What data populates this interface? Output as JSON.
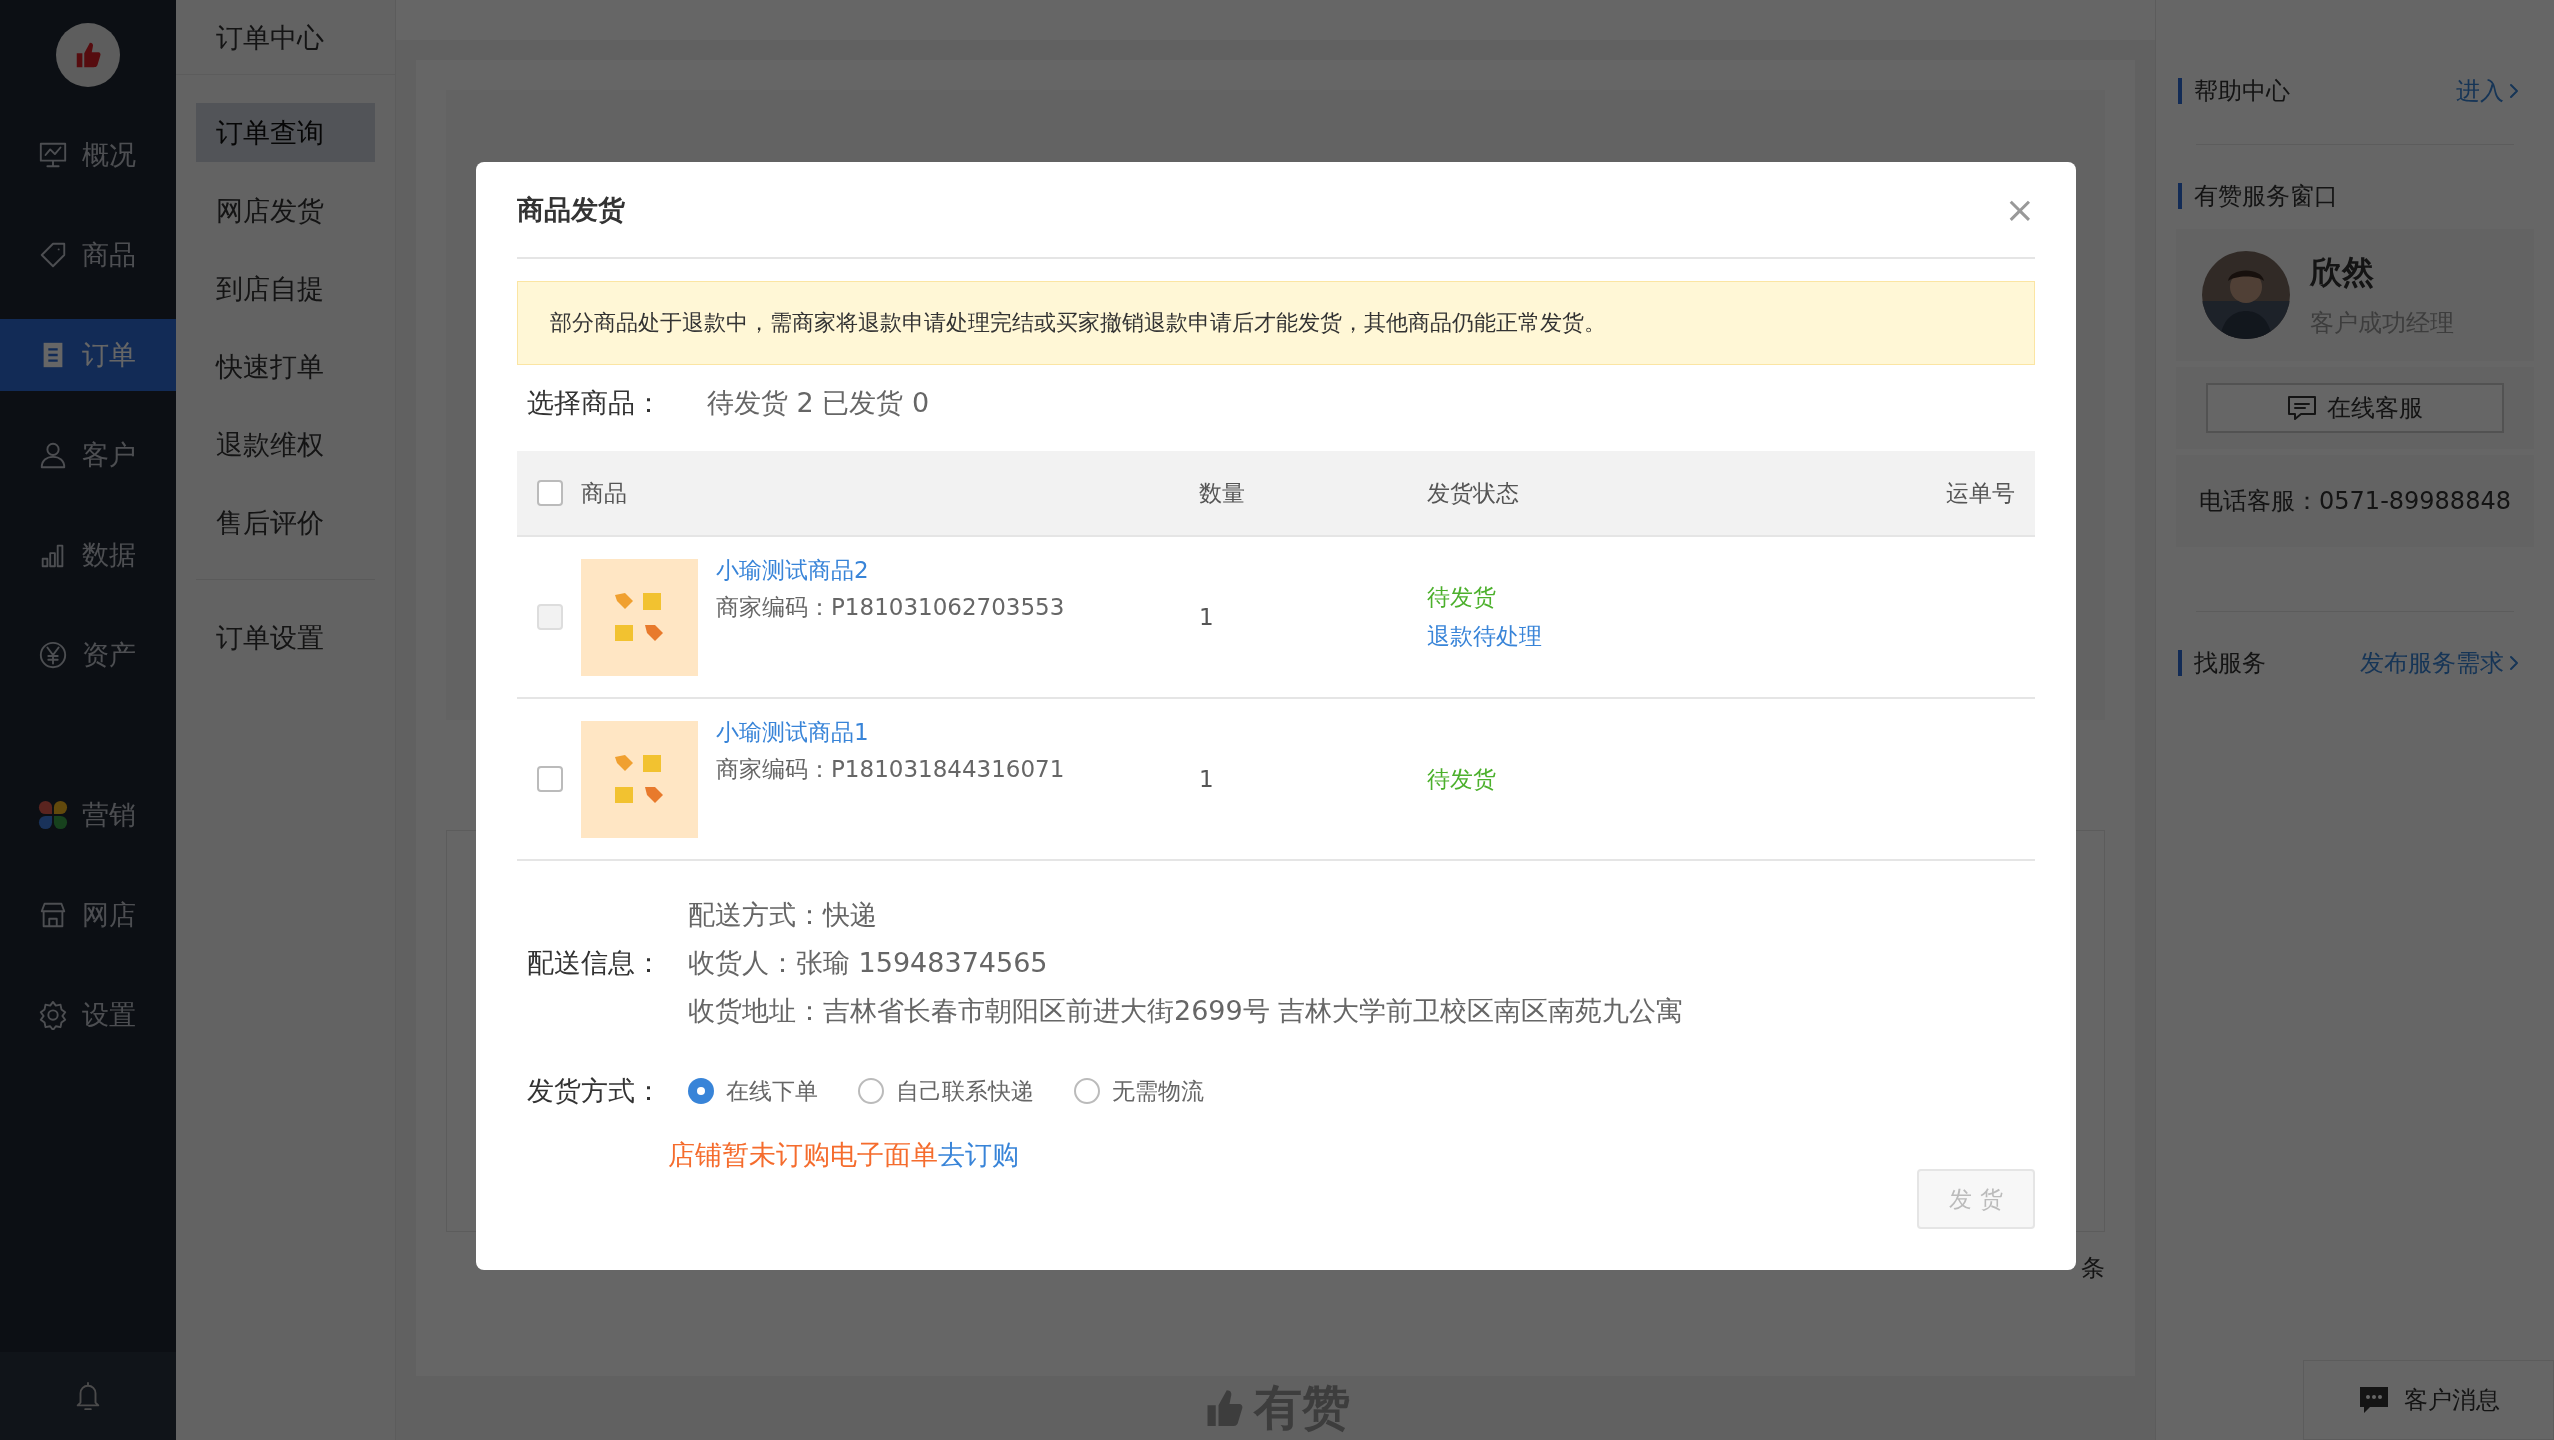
{
  "sidebar": {
    "items": [
      {
        "label": "概况",
        "selected": false
      },
      {
        "label": "商品",
        "selected": false
      },
      {
        "label": "订单",
        "selected": true
      },
      {
        "label": "客户",
        "selected": false
      },
      {
        "label": "数据",
        "selected": false
      },
      {
        "label": "资产",
        "selected": false
      },
      {
        "label": "营销",
        "selected": false
      },
      {
        "label": "网店",
        "selected": false
      },
      {
        "label": "设置",
        "selected": false
      }
    ]
  },
  "submenu": {
    "title": "订单中心",
    "groups": [
      [
        {
          "label": "订单查询",
          "selected": true
        },
        {
          "label": "网店发货",
          "selected": false
        },
        {
          "label": "到店自提",
          "selected": false
        },
        {
          "label": "快速打单",
          "selected": false
        },
        {
          "label": "退款维权",
          "selected": false
        },
        {
          "label": "售后评价",
          "selected": false
        }
      ],
      [
        {
          "label": "订单设置",
          "selected": false
        }
      ]
    ]
  },
  "main": {
    "pagination_tail": "条",
    "footer_logo": "有赞"
  },
  "right_panel": {
    "help": {
      "title": "帮助中心",
      "link": "进入"
    },
    "service": {
      "title": "有赞服务窗口",
      "name": "欣然",
      "role": "客户成功经理",
      "button": "在线客服",
      "phone": "电话客服：0571-89988848"
    },
    "find": {
      "title": "找服务",
      "link": "发布服务需求"
    },
    "messages": "客户消息"
  },
  "modal": {
    "title": "商品发货",
    "close": "×",
    "alert": "部分商品处于退款中，需商家将退款申请处理完结或买家撤销退款申请后才能发货，其他商品仍能正常发货。",
    "select_label": "选择商品：",
    "select_summary": "待发货 2 已发货 0",
    "select_all_checked": false,
    "columns": [
      "商品",
      "数量",
      "发货状态",
      "运单号"
    ],
    "rows": [
      {
        "name": "小瑜测试商品2",
        "code": "商家编码：P181031062703553",
        "qty": "1",
        "checked": false,
        "disabled": true,
        "statuses": [
          {
            "text": "待发货",
            "kind": "pending"
          },
          {
            "text": "退款待处理",
            "kind": "refund"
          }
        ]
      },
      {
        "name": "小瑜测试商品1",
        "code": "商家编码：P181031844316071",
        "qty": "1",
        "checked": false,
        "disabled": false,
        "statuses": [
          {
            "text": "待发货",
            "kind": "pending"
          }
        ]
      }
    ],
    "delivery": {
      "label": "配送信息：",
      "lines": [
        "配送方式：快递",
        "收货人：张瑜 15948374565",
        "收货地址：吉林省长春市朝阳区前进大街2699号 吉林大学前卫校区南区南苑九公寓"
      ]
    },
    "ship_method": {
      "label": "发货方式：",
      "options": [
        {
          "label": "在线下单",
          "selected": true
        },
        {
          "label": "自己联系快递",
          "selected": false
        },
        {
          "label": "无需物流",
          "selected": false
        }
      ]
    },
    "notice": {
      "text": "店铺暂未订购电子面单",
      "link": "去订购"
    },
    "submit": {
      "label": "发 货",
      "disabled": true
    }
  }
}
